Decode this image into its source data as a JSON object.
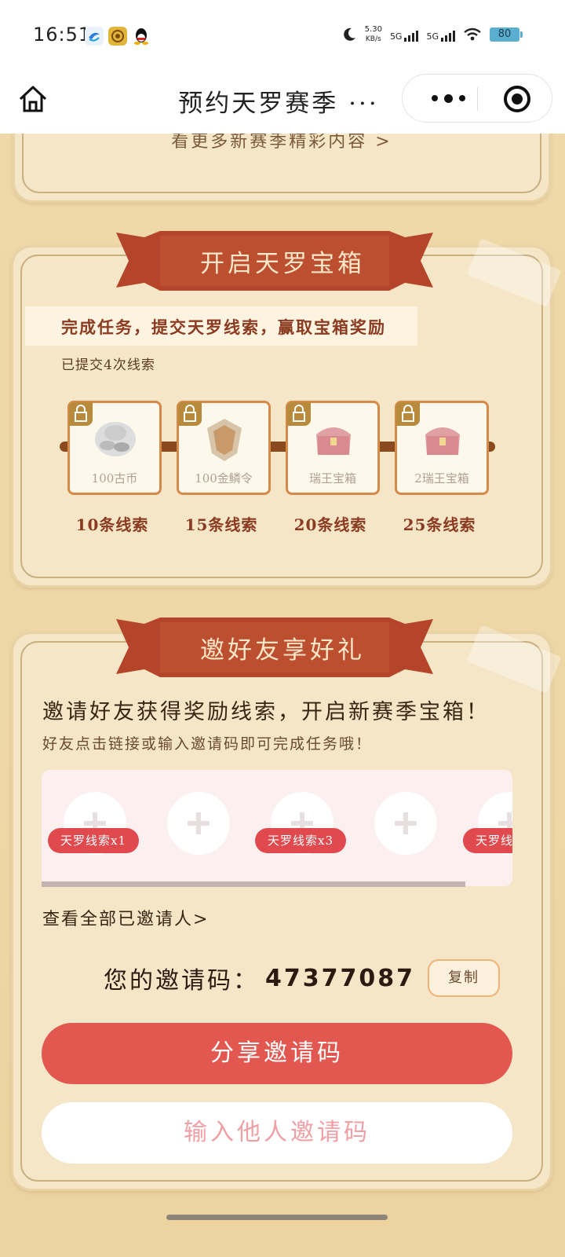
{
  "status_bar": {
    "time": "16:51",
    "speed_value": "5.30",
    "speed_unit": "KB/s",
    "net1": "5G",
    "net2": "5G",
    "battery": "80"
  },
  "nav": {
    "title": "预约天罗赛季 ···"
  },
  "top_card": {
    "more_link": "看更多新赛季精彩内容 >"
  },
  "chest_section": {
    "banner": "开启天罗宝箱",
    "task_text": "完成任务，提交天罗线索，赢取宝箱奖励",
    "submitted": "已提交4次线索",
    "rewards": [
      {
        "name": "100古币",
        "condition": "10条线索"
      },
      {
        "name": "100金鳞令",
        "condition": "15条线索"
      },
      {
        "name": "瑞王宝箱",
        "condition": "20条线索"
      },
      {
        "name": "2瑞王宝箱",
        "condition": "25条线索"
      }
    ]
  },
  "invite_section": {
    "banner": "邀好友享好礼",
    "title": "邀请好友获得奖励线索，开启新赛季宝箱！",
    "subtitle": "好友点击链接或输入邀请码即可完成任务哦！",
    "slot_tags": [
      "天罗线索x1",
      "天罗线索x3",
      "天罗线"
    ],
    "view_all": "查看全部已邀请人>",
    "code_label": "您的邀请码：",
    "code_value": "47377087",
    "copy_label": "复制",
    "share_label": "分享邀请码",
    "enter_label": "输入他人邀请码"
  },
  "colors": {
    "accent_red": "#e2574f",
    "banner_red": "#b5452a",
    "background": "#edd6a6",
    "paper": "#f5e6c8"
  }
}
